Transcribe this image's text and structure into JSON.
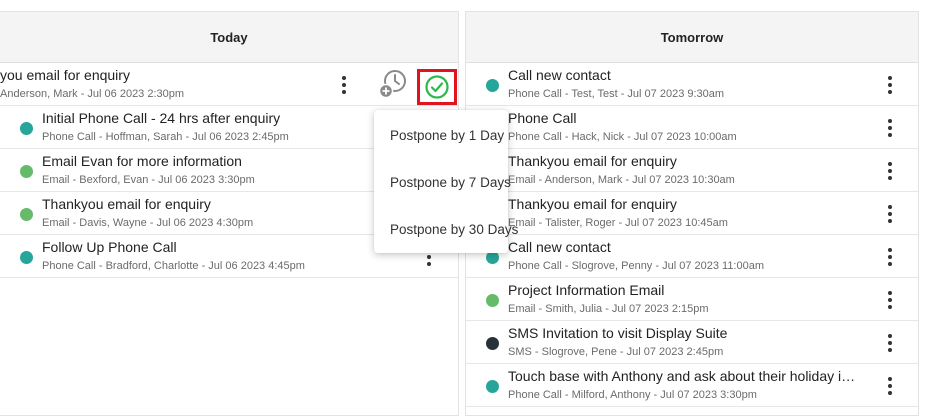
{
  "colors": {
    "teal": "#26a69a",
    "green": "#66bb6a",
    "dark": "#263238",
    "check": "#2eb84a",
    "highlight": "#e0141f"
  },
  "today": {
    "header": "Today",
    "tasks": [
      {
        "title": "you email for enquiry",
        "sub": "Anderson, Mark - Jul 06 2023 2:30pm",
        "color": ""
      },
      {
        "title": "Initial Phone Call - 24 hrs after enquiry",
        "sub": "Phone Call - Hoffman, Sarah - Jul 06 2023 2:45pm",
        "color": "#26a69a"
      },
      {
        "title": "Email Evan for more information",
        "sub": "Email - Bexford, Evan - Jul 06 2023 3:30pm",
        "color": "#66bb6a"
      },
      {
        "title": "Thankyou email for enquiry",
        "sub": "Email - Davis, Wayne - Jul 06 2023 4:30pm",
        "color": "#66bb6a"
      },
      {
        "title": "Follow Up Phone Call",
        "sub": "Phone Call - Bradford, Charlotte - Jul 06 2023 4:45pm",
        "color": "#26a69a"
      }
    ]
  },
  "tomorrow": {
    "header": "Tomorrow",
    "tasks": [
      {
        "title": "Call new contact",
        "sub": "Phone Call - Test, Test - Jul 07 2023 9:30am",
        "color": "#26a69a"
      },
      {
        "title": "Phone Call",
        "sub": "Phone Call - Hack, Nick - Jul 07 2023 10:00am",
        "color": "#26a69a"
      },
      {
        "title": "Thankyou email for enquiry",
        "sub": "Email - Anderson, Mark - Jul 07 2023 10:30am",
        "color": "#66bb6a"
      },
      {
        "title": "Thankyou email for enquiry",
        "sub": "Email - Talister, Roger - Jul 07 2023 10:45am",
        "color": "#66bb6a"
      },
      {
        "title": "Call new contact",
        "sub": "Phone Call - Slogrove, Penny - Jul 07 2023 11:00am",
        "color": "#26a69a"
      },
      {
        "title": "Project Information Email",
        "sub": "Email - Smith, Julia - Jul 07 2023 2:15pm",
        "color": "#66bb6a"
      },
      {
        "title": "SMS Invitation to visit Display Suite",
        "sub": "SMS - Slogrove, Pene - Jul 07 2023 2:45pm",
        "color": "#263238"
      },
      {
        "title": "Touch base with Anthony and ask about their holiday in Bali",
        "sub": "Phone Call - Milford, Anthony - Jul 07 2023 3:30pm",
        "color": "#26a69a"
      }
    ]
  },
  "postpone_menu": {
    "items": [
      "Postpone by 1 Day",
      "Postpone by 7 Days",
      "Postpone by 30 Days"
    ]
  },
  "icons": {
    "postpone": "clock-plus-icon",
    "complete": "check-circle-icon",
    "more": "more-vertical-icon"
  }
}
